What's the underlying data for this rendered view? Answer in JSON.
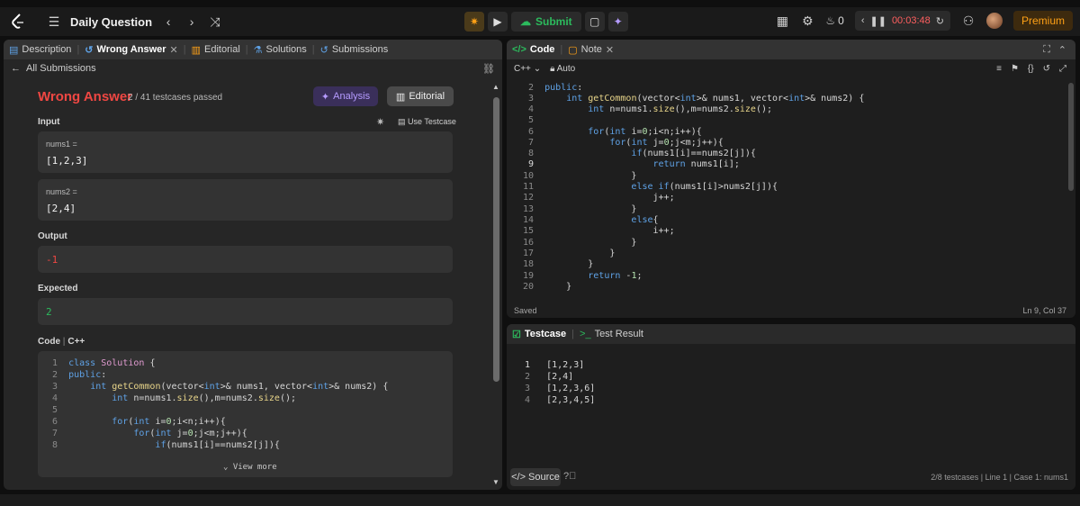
{
  "nav": {
    "title": "Daily Question",
    "submit_label": "Submit",
    "streak": "0",
    "timer": "00:03:48",
    "premium_label": "Premium"
  },
  "left_tabs": [
    {
      "label": "Description"
    },
    {
      "label": "Wrong Answer"
    },
    {
      "label": "Editorial"
    },
    {
      "label": "Solutions"
    },
    {
      "label": "Submissions"
    }
  ],
  "submission": {
    "back_label": "All Submissions",
    "status": "Wrong Answer",
    "testcases": "2 / 41 testcases passed",
    "analysis_label": "Analysis",
    "editorial_label": "Editorial",
    "input_label": "Input",
    "use_testcase_label": "Use Testcase",
    "inputs": [
      {
        "name": "nums1 =",
        "value": "[1,2,3]"
      },
      {
        "name": "nums2 =",
        "value": "[2,4]"
      }
    ],
    "output_label": "Output",
    "output_value": "-1",
    "expected_label": "Expected",
    "expected_value": "2",
    "code_label": "Code",
    "code_lang": "C++",
    "view_more": "View more"
  },
  "code_tabs": [
    {
      "label": "Code"
    },
    {
      "label": "Note"
    }
  ],
  "editor": {
    "language": "C++",
    "mode": "Auto",
    "saved": "Saved",
    "cursor": "Ln 9, Col 37"
  },
  "test_tabs": [
    {
      "label": "Testcase"
    },
    {
      "label": "Test Result"
    }
  ],
  "testcase_lines": [
    {
      "n": "1",
      "t": "[1,2,3]"
    },
    {
      "n": "2",
      "t": "[2,4]"
    },
    {
      "n": "3",
      "t": "[1,2,3,6]"
    },
    {
      "n": "4",
      "t": "[2,3,4,5]"
    }
  ],
  "test_footer": {
    "source_label": "Source",
    "info": "2/8 testcases  |  Line 1  |  Case 1: nums1"
  },
  "colors": {
    "accent": "#ffa116",
    "error": "#ef4743",
    "success": "#2cbb5d"
  }
}
